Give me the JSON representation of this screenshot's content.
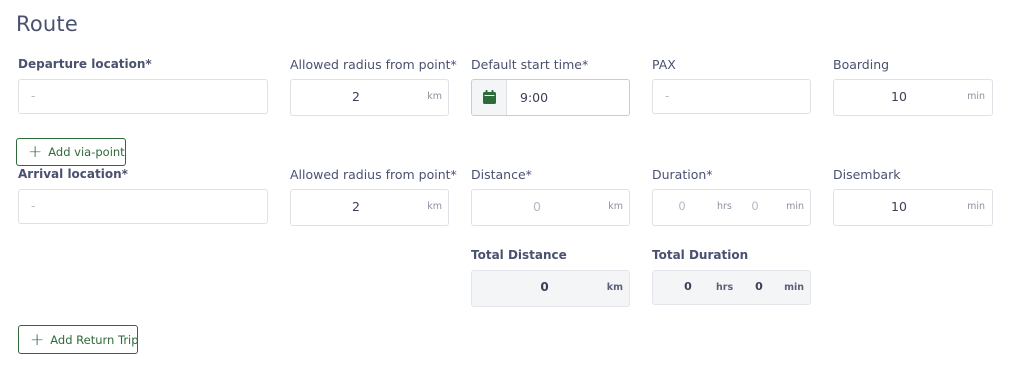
{
  "section": {
    "title": "Route"
  },
  "departure": {
    "location": {
      "label": "Departure location*",
      "placeholder": "-"
    },
    "radius": {
      "label": "Allowed radius from point*",
      "value": "2",
      "unit": "km"
    },
    "start_time": {
      "label": "Default start time*",
      "value": "9:00",
      "icon": "calendar-icon"
    },
    "pax": {
      "label": "PAX",
      "placeholder": "-"
    },
    "boarding": {
      "label": "Boarding",
      "value": "10",
      "unit": "min"
    }
  },
  "add_via_point": {
    "label": "Add via-point"
  },
  "arrival": {
    "location": {
      "label": "Arrival location*",
      "placeholder": "-"
    },
    "radius": {
      "label": "Allowed radius from point*",
      "value": "2",
      "unit": "km"
    },
    "distance": {
      "label": "Distance*",
      "value": "0",
      "unit": "km"
    },
    "duration": {
      "label": "Duration*",
      "hours": "0",
      "hours_unit": "hrs",
      "minutes": "0",
      "minutes_unit": "min"
    },
    "disembark": {
      "label": "Disembark",
      "value": "10",
      "unit": "min"
    }
  },
  "totals": {
    "distance": {
      "label": "Total Distance",
      "value": "0",
      "unit": "km"
    },
    "duration": {
      "label": "Total Duration",
      "hours": "0",
      "hours_unit": "hrs",
      "minutes": "0",
      "minutes_unit": "min"
    }
  },
  "add_return_trip": {
    "label": "Add Return Trip"
  },
  "colors": {
    "accent": "#2e6b3a",
    "text": "#4a5170",
    "border": "#dfe1e6",
    "readonly_bg": "#f4f5f7"
  }
}
